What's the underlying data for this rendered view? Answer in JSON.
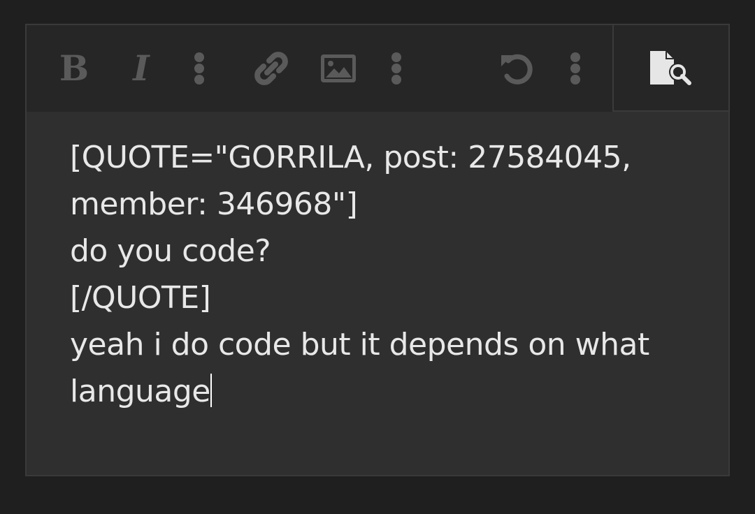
{
  "toolbar": {
    "buttons": [
      {
        "name": "bold",
        "icon": "bold-icon",
        "label": "B"
      },
      {
        "name": "italic",
        "icon": "italic-icon",
        "label": "I"
      },
      {
        "name": "more-text",
        "icon": "vertical-ellipsis-icon"
      },
      {
        "name": "link",
        "icon": "link-icon"
      },
      {
        "name": "image",
        "icon": "image-icon"
      },
      {
        "name": "more-insert",
        "icon": "vertical-ellipsis-icon"
      },
      {
        "name": "undo",
        "icon": "undo-icon"
      },
      {
        "name": "more-options",
        "icon": "vertical-ellipsis-icon"
      }
    ],
    "preview": {
      "icon": "preview-document-search-icon"
    },
    "icon_color": "#5a5a5a",
    "preview_icon_color": "#e6e6e6"
  },
  "editor": {
    "lines": [
      "[QUOTE=\"GORRILA, post: 27584045, member: 346968\"]",
      "do you code?",
      "[/QUOTE]",
      "yeah i do code but it depends on what language"
    ],
    "text_color": "#e8e8e8",
    "background": "#2f2f2f"
  }
}
